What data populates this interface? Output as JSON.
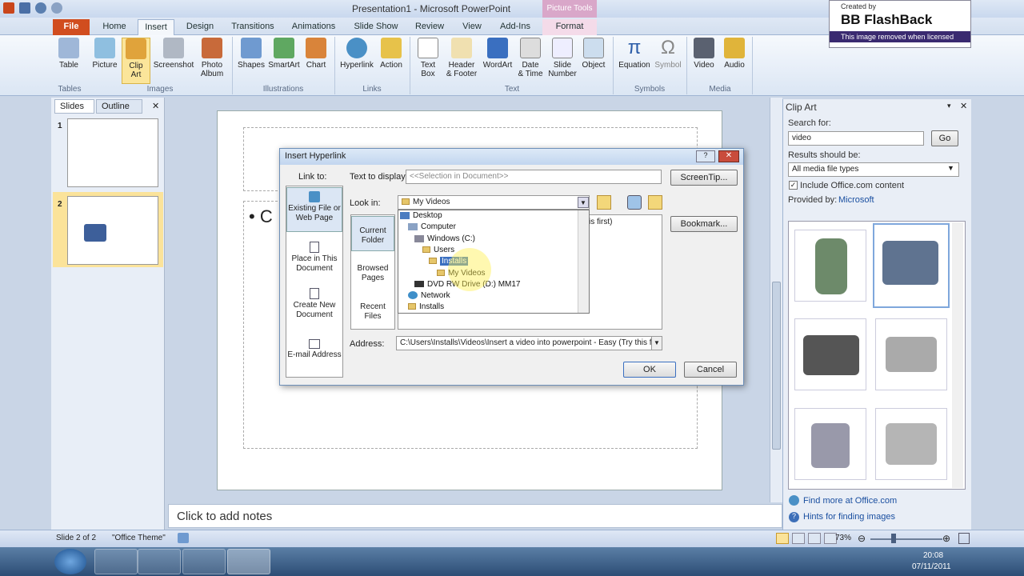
{
  "window": {
    "title": "Presentation1 - Microsoft PowerPoint",
    "contextual_tab_group": "Picture Tools"
  },
  "tabs": [
    "File",
    "Home",
    "Insert",
    "Design",
    "Transitions",
    "Animations",
    "Slide Show",
    "Review",
    "View",
    "Add-Ins",
    "Format"
  ],
  "ribbon": {
    "buttons": [
      {
        "label": "Table"
      },
      {
        "label": "Picture"
      },
      {
        "label": "Clip\nArt"
      },
      {
        "label": "Screenshot"
      },
      {
        "label": "Photo\nAlbum"
      },
      {
        "label": "Shapes"
      },
      {
        "label": "SmartArt"
      },
      {
        "label": "Chart"
      },
      {
        "label": "Hyperlink"
      },
      {
        "label": "Action"
      },
      {
        "label": "Text\nBox"
      },
      {
        "label": "Header\n& Footer"
      },
      {
        "label": "WordArt"
      },
      {
        "label": "Date\n& Time"
      },
      {
        "label": "Slide\nNumber"
      },
      {
        "label": "Object"
      },
      {
        "label": "Equation"
      },
      {
        "label": "Symbol"
      },
      {
        "label": "Video"
      },
      {
        "label": "Audio"
      }
    ],
    "groups": [
      "Tables",
      "Images",
      "Illustrations",
      "Links",
      "Text",
      "Symbols",
      "Media"
    ]
  },
  "watermark": {
    "line1": "Created by",
    "line2": "BB FlashBack",
    "line3": "This image removed when licensed"
  },
  "slides_pane": {
    "tab_slides": "Slides",
    "tab_outline": "Outline",
    "close": "✕",
    "thumb_numbers": [
      "1",
      "2"
    ]
  },
  "slide": {
    "bullet_text": "• C"
  },
  "notes": {
    "placeholder": "Click to add notes"
  },
  "clip_art": {
    "title": "Clip Art",
    "search_label": "Search for:",
    "search_value": "video",
    "go_label": "Go",
    "results_label": "Results should be:",
    "results_value": "All media file types",
    "include_label": "Include Office.com content",
    "provided_by_label": "Provided by:",
    "provided_by_value": "Microsoft",
    "link_more": "Find more at Office.com",
    "link_hints": "Hints for finding images"
  },
  "dialog": {
    "title": "Insert Hyperlink",
    "link_to_label": "Link to:",
    "text_to_display_label": "Text to display:",
    "text_to_display_value": "<<Selection in Document>>",
    "screentip_label": "ScreenTip...",
    "look_in_label": "Look in:",
    "look_in_value": "My Videos",
    "bookmark_label": "Bookmark...",
    "address_label": "Address:",
    "address_value": "C:\\Users\\Installs\\Videos\\Insert a video into powerpoint - Easy (Try this fi",
    "behind_text": "is first)",
    "ok_label": "OK",
    "cancel_label": "Cancel",
    "link_options": [
      "Existing File or Web Page",
      "Place in This Document",
      "Create New Document",
      "E-mail Address"
    ],
    "look_options": [
      "Current Folder",
      "Browsed Pages",
      "Recent Files"
    ],
    "tree": [
      "Desktop",
      "Computer",
      "Windows (C:)",
      "Users",
      "Installs",
      "My Videos",
      "DVD RW Drive (D:) MM17",
      "Network",
      "Installs"
    ]
  },
  "status": {
    "slide_info": "Slide 2 of 2",
    "theme": "\"Office Theme\"",
    "zoom": "73%"
  },
  "clock": {
    "time": "20:08",
    "date": "07/11/2011"
  }
}
